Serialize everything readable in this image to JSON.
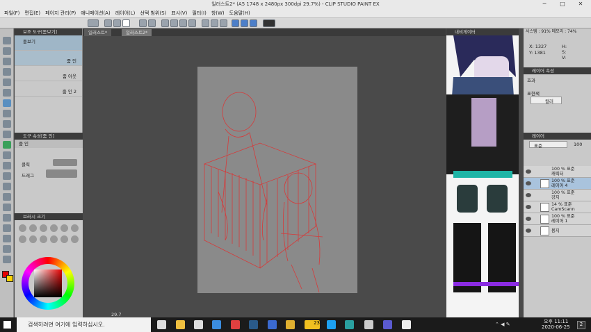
{
  "app": {
    "title": "일러스트2* (A5 1748 x 2480px 300dpi 29.7%) - CLIP STUDIO PAINT EX"
  },
  "menu": [
    "파일(F)",
    "편집(E)",
    "페이지 관리(P)",
    "애니메이션(A)",
    "레이어(L)",
    "선택 범위(S)",
    "표시(V)",
    "필터(I)",
    "창(W)",
    "도움말(H)"
  ],
  "subtool": {
    "title": "보조 도구[돋보기]",
    "items": [
      {
        "label": "돋보기",
        "value": "줌 인"
      },
      {
        "label": "",
        "value": "줌 아웃"
      },
      {
        "label": "",
        "value": "줌 인 2"
      }
    ]
  },
  "toolprop": {
    "title": "도구 속성[줌 인]",
    "name": "줌 인",
    "click_label": "클릭",
    "drag_label": "드래그"
  },
  "brushsize": {
    "title": "브러시 크기"
  },
  "canvas_tabs": [
    "일러스트*",
    "일러스트2*"
  ],
  "zoom": "29.7",
  "status": {
    "zoom_value": "100"
  },
  "navigator": {
    "tab": "내비게이터",
    "info": "사스템 : 91% 메모리 : 74%",
    "x": "X: 1327",
    "y": "Y: 1381",
    "h": "H:",
    "s": "S:",
    "v": "V:"
  },
  "layerprop": {
    "title": "레이어 속성",
    "effect_label": "효과",
    "color_label": "표현색",
    "color_value": "컬러"
  },
  "layers_panel": {
    "title": "레이어",
    "blend": "표준",
    "opacity": "100"
  },
  "layers": [
    {
      "mode": "100 % 표준",
      "name": "캐릭터",
      "type": "folder"
    },
    {
      "mode": "100 % 표준",
      "name": "레이어 4",
      "type": "raster",
      "selected": true
    },
    {
      "mode": "100 % 표준",
      "name": "강지",
      "type": "folder"
    },
    {
      "mode": "14 % 표준",
      "name": "CamScann",
      "type": "raster"
    },
    {
      "mode": "100 % 표준",
      "name": "레이어 1",
      "type": "raster"
    },
    {
      "mode": "",
      "name": "용지",
      "type": "paper"
    }
  ],
  "taskbar": {
    "search_placeholder": "검색하려면 여기에 입력하십시오.",
    "time": "오후 11:11",
    "date": "2020-06-25",
    "badge": "23",
    "notif": "2"
  },
  "colors": {
    "main": "#e60000",
    "sub": "#ffd400"
  }
}
